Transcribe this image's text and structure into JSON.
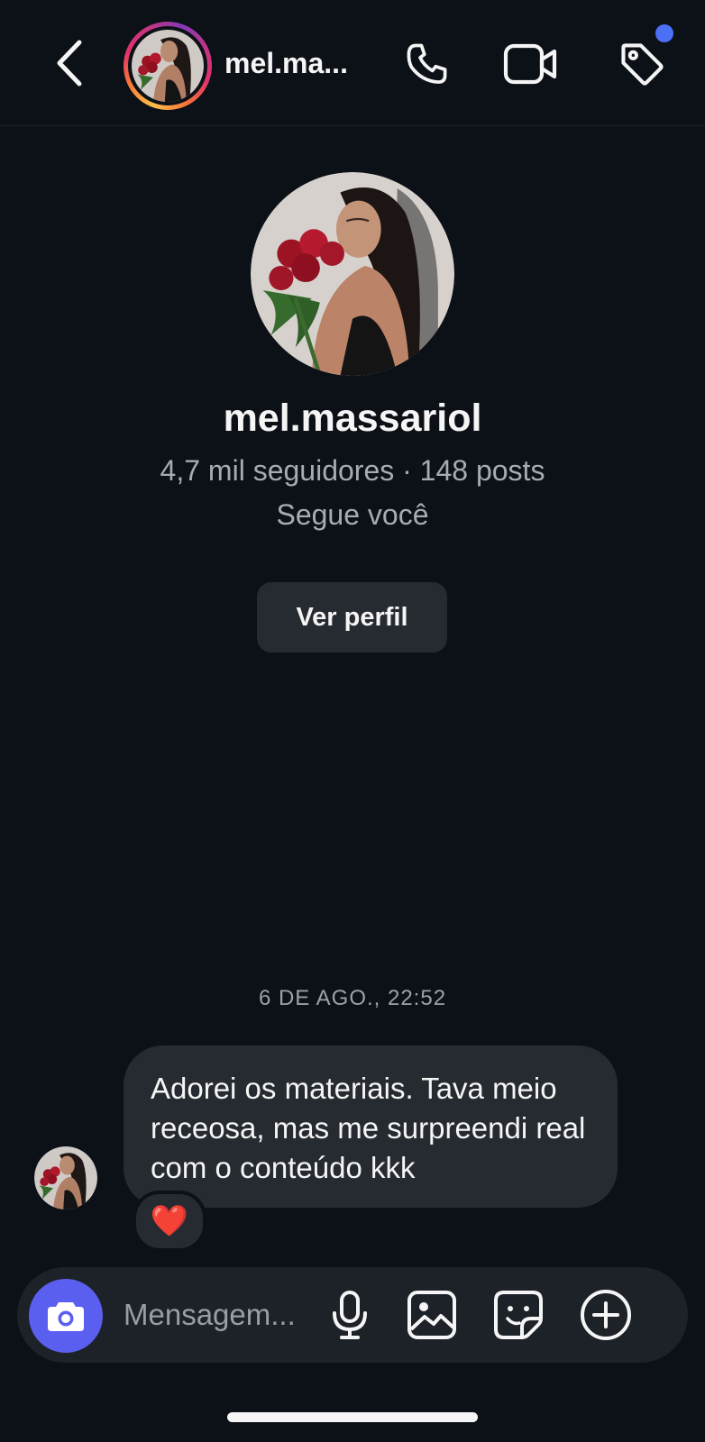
{
  "header": {
    "username_truncated": "mel.ma...",
    "icons": {
      "back": "chevron-left-icon",
      "call": "phone-icon",
      "video": "video-camera-icon",
      "tag": "tag-icon"
    },
    "notification_dot_color": "#4b6ff5"
  },
  "profile": {
    "username": "mel.massariol",
    "stats": "4,7 mil seguidores · 148 posts",
    "follows_you": "Segue você",
    "view_profile_label": "Ver perfil"
  },
  "chat": {
    "timestamp": "6 DE AGO., 22:52",
    "messages": [
      {
        "sender": "mel.massariol",
        "text": "Adorei os materiais. Tava meio receosa, mas me surpreendi real com o conteúdo kkk",
        "reaction": "❤️"
      }
    ]
  },
  "composer": {
    "placeholder": "Mensagem...",
    "icons": [
      "camera-icon",
      "microphone-icon",
      "image-icon",
      "sticker-icon",
      "plus-circle-icon"
    ],
    "camera_button_color": "#5b5ff0"
  },
  "colors": {
    "background": "#0c1017",
    "bubble": "#262a31",
    "secondary_text": "#a8abb2"
  }
}
